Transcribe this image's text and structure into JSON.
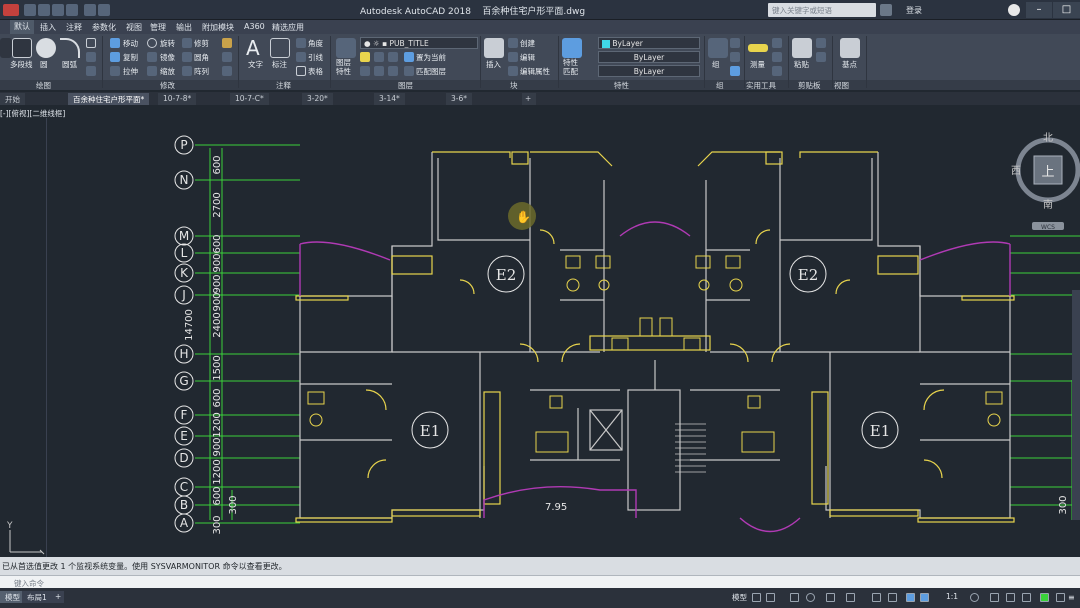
{
  "app": {
    "title": "Autodesk AutoCAD 2018",
    "file": "百余种住宅户形平面.dwg",
    "search_placeholder": "键入关键字或短语",
    "login_label": "登录"
  },
  "ribbon_tabs": [
    "默认",
    "插入",
    "注释",
    "参数化",
    "视图",
    "管理",
    "输出",
    "附加模块",
    "A360",
    "精选应用"
  ],
  "ribbon": {
    "draw": {
      "line": "直线",
      "polyline": "多段线",
      "circle": "圆",
      "arc": "圆弧"
    },
    "modify": {
      "move": "移动",
      "rotate": "旋转",
      "trim": "修剪",
      "copy": "复制",
      "mirror": "镜像",
      "fillet": "圆角",
      "stretch": "拉伸",
      "scale": "缩放",
      "array": "阵列"
    },
    "annotation": {
      "text": "文字",
      "dimension": "标注",
      "angular": "角度",
      "leader": "引线",
      "table": "表格"
    },
    "layers": {
      "layer_props": "图层特性",
      "current_layer": "PUB_TITLE",
      "set_current": "置为当前",
      "match_layer": "匹配图层"
    },
    "block": {
      "insert": "插入",
      "create": "创建",
      "edit": "编辑",
      "edit_attr": "编辑属性"
    },
    "properties": {
      "match": "特性匹配",
      "color": "ByLayer",
      "linetype": "ByLayer",
      "lineweight": "ByLayer"
    },
    "groups": {
      "group": "组"
    },
    "utilities": {
      "measure": "测量"
    },
    "clipboard": {
      "paste": "粘贴"
    },
    "view": {
      "base": "基点"
    }
  },
  "panel_labels": {
    "draw": "绘图",
    "modify": "修改",
    "annotation": "注释",
    "layers": "图层",
    "block": "块",
    "properties": "特性",
    "groups": "组",
    "utilities": "实用工具",
    "clipboard": "剪贴板",
    "view": "视图"
  },
  "doc_tabs": [
    "开始",
    "百余种住宅户形平面*",
    "10-7-8*",
    "10-7-C*",
    "3-20*",
    "3-14*",
    "3-6*"
  ],
  "viewport_label": "[-][俯视][二维线框]",
  "viewcube": {
    "north": "北",
    "south": "南",
    "west": "西",
    "top": "上",
    "wcs": "WCS"
  },
  "axes": {
    "letters": [
      "P",
      "N",
      "M",
      "L",
      "K",
      "J",
      "H",
      "G",
      "F",
      "E",
      "D",
      "C",
      "B",
      "A"
    ],
    "dims": [
      "600",
      "2700",
      "600",
      "900",
      "900",
      "900",
      "2400",
      "1500",
      "600",
      "1200",
      "900",
      "1200",
      "600",
      "300"
    ],
    "total": "14700",
    "bottom": "300",
    "right_bottom": "300"
  },
  "plan": {
    "unit_labels": [
      "E2",
      "E2",
      "E1",
      "E1"
    ],
    "elevation_label": "7.95"
  },
  "ucs": {
    "y": "Y"
  },
  "command": {
    "history": "已从首选值更改 1 个监视系统变量。使用 SYSVARMONITOR 命令以查看更改。",
    "placeholder": "键入命令"
  },
  "layout_tabs": [
    "模型",
    "布局1"
  ],
  "status": {
    "model": "模型",
    "scale": "1:1"
  },
  "colors": {
    "background": "#212830",
    "walls": "#c8c8c8",
    "yellow": "#e8d44d",
    "green": "#3ad13a",
    "magenta": "#b03ab4",
    "cyan": "#40d8e8"
  }
}
